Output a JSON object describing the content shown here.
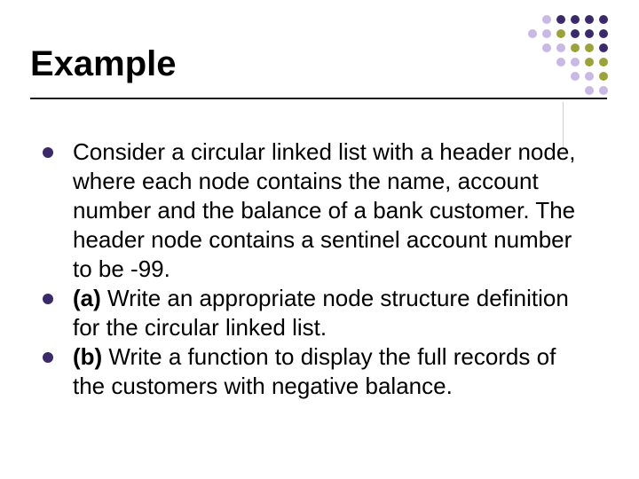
{
  "title": "Example",
  "colors": {
    "bullet": "#3b2a6b",
    "dot_dark": "#3b2a6b",
    "dot_olive": "#9da23a",
    "dot_lilac": "#c9b8e6"
  },
  "points": {
    "p1": "Consider a circular linked list with a header node, where each node contains the name, account number and the balance of a bank customer. The header node contains a sentinel account number to be -99.",
    "p2_label": "(a)",
    "p2_text": " Write an appropriate node structure definition for the circular linked list.",
    "p3_label": "(b)",
    "p3_text": " Write a function to display the full records of the customers with negative balance."
  }
}
